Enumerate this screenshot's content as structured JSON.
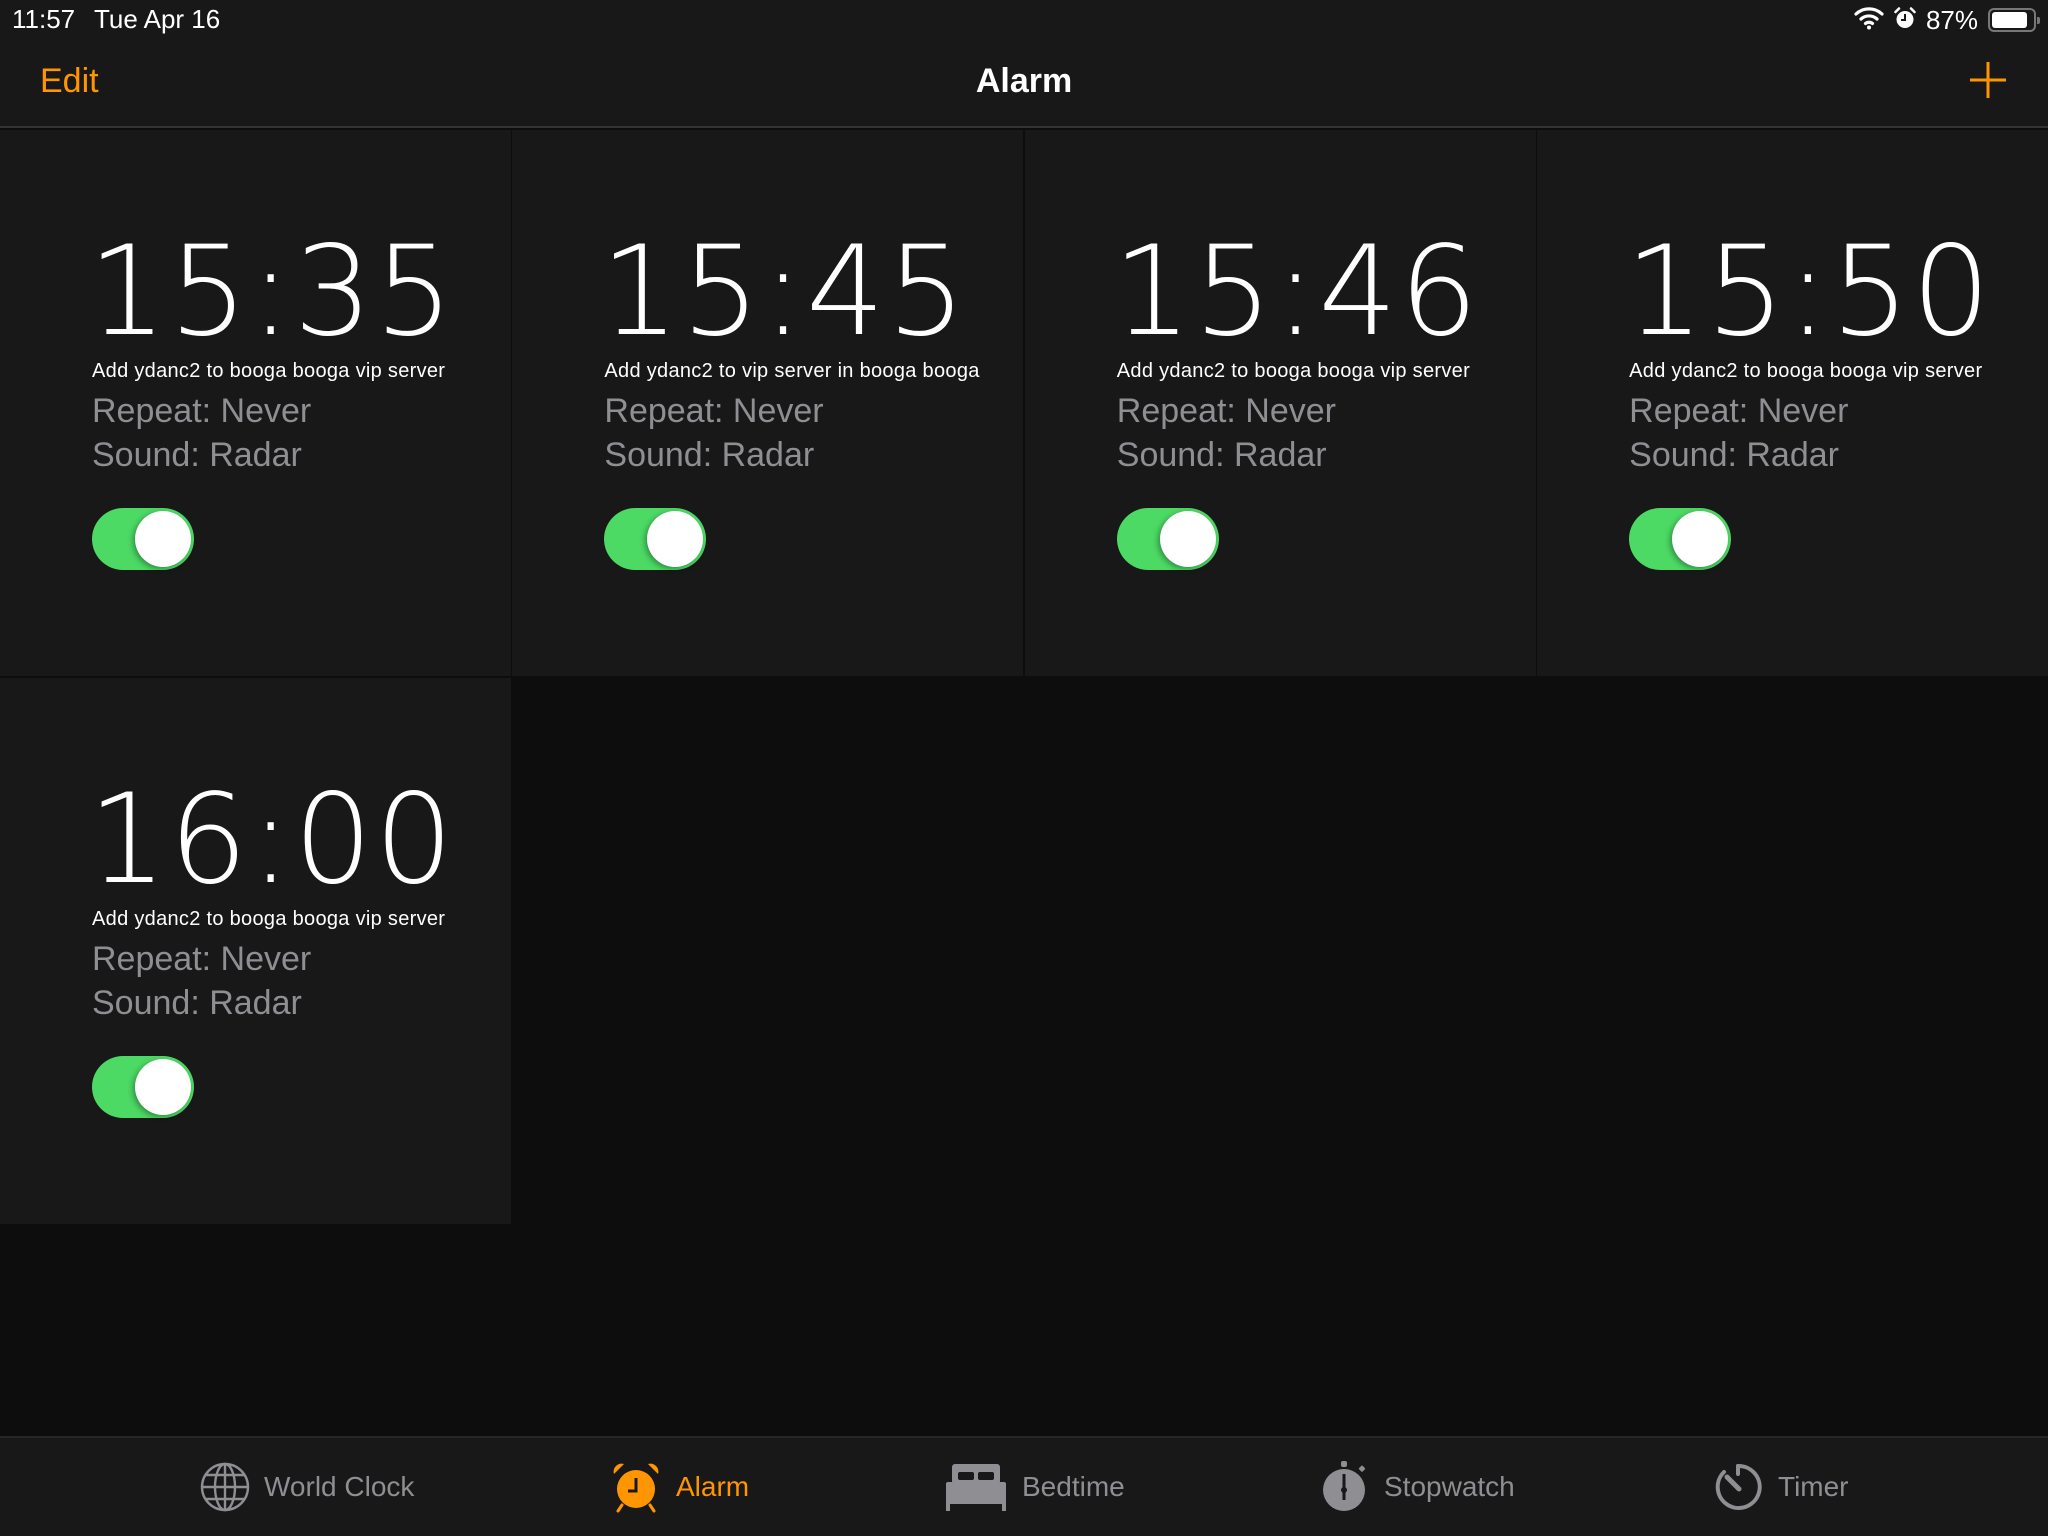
{
  "status_bar": {
    "time": "11:57",
    "date": "Tue Apr 16",
    "icons": [
      "wifi-icon",
      "alarm-clock-icon",
      "battery-icon"
    ],
    "battery_percent": "87%",
    "battery_level": 0.87
  },
  "nav": {
    "edit_label": "Edit",
    "title": "Alarm",
    "add_icon": "plus-icon"
  },
  "colors": {
    "accent": "#ff9500",
    "toggle_on": "#4cd964",
    "secondary_text": "#8e8e93",
    "card_bg": "#181818",
    "page_bg": "#0d0d0d"
  },
  "alarms": [
    {
      "time": "15:35",
      "label": "Add ydanc2 to booga booga vip server",
      "repeat": "Repeat: Never",
      "sound": "Sound: Radar",
      "enabled": true
    },
    {
      "time": "15:45",
      "label": "Add ydanc2 to vip server in booga booga",
      "repeat": "Repeat: Never",
      "sound": "Sound: Radar",
      "enabled": true
    },
    {
      "time": "15:46",
      "label": "Add ydanc2 to booga booga vip server",
      "repeat": "Repeat: Never",
      "sound": "Sound: Radar",
      "enabled": true
    },
    {
      "time": "15:50",
      "label": "Add ydanc2 to booga booga vip server",
      "repeat": "Repeat: Never",
      "sound": "Sound: Radar",
      "enabled": true
    },
    {
      "time": "16:00",
      "label": "Add ydanc2 to booga booga vip server",
      "repeat": "Repeat: Never",
      "sound": "Sound: Radar",
      "enabled": true
    }
  ],
  "tabs": [
    {
      "label": "World Clock",
      "icon": "globe-icon",
      "active": false
    },
    {
      "label": "Alarm",
      "icon": "alarm-clock-icon",
      "active": true
    },
    {
      "label": "Bedtime",
      "icon": "bed-icon",
      "active": false
    },
    {
      "label": "Stopwatch",
      "icon": "stopwatch-icon",
      "active": false
    },
    {
      "label": "Timer",
      "icon": "timer-icon",
      "active": false
    }
  ]
}
